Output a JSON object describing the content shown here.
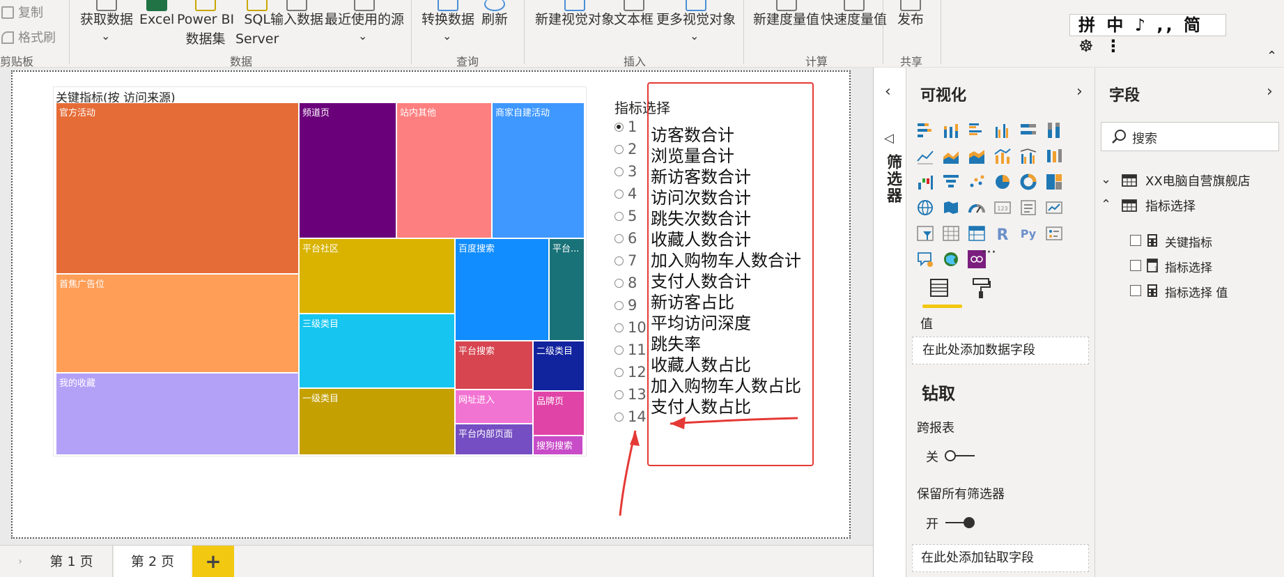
{
  "ribbon": {
    "clipboard": {
      "copy": "复制",
      "format_painter": "格式刷",
      "group": "剪贴板"
    },
    "data": {
      "get_data": "获取数据",
      "excel": "Excel",
      "powerbi_line1": "Power BI",
      "powerbi_line2": "数据集",
      "sql_line1": "SQL",
      "sql_line2": "Server",
      "enter_data": "输入数据",
      "recent_sources": "最近使用的源",
      "group": "数据"
    },
    "query": {
      "transform": "转换数据",
      "refresh": "刷新",
      "group": "查询"
    },
    "insert": {
      "new_visual": "新建视觉对象",
      "text_box": "文本框",
      "more_visuals": "更多视觉对象",
      "group": "插入"
    },
    "calc": {
      "new_measure": "新建度量值",
      "quick_measure": "快速度量值",
      "group": "计算"
    },
    "share": {
      "publish": "发布",
      "group": "共享"
    },
    "ime": "拼 中 ♪ ,, 简 ☸ ⋮"
  },
  "treemap": {
    "title": "关键指标(按 访问来源)",
    "tiles": [
      {
        "label": "官方活动",
        "color": "#E66C37"
      },
      {
        "label": "首焦广告位",
        "color": "#FE9E57"
      },
      {
        "label": "我的收藏",
        "color": "#B3A1F7"
      },
      {
        "label": "频道页",
        "color": "#6B007B"
      },
      {
        "label": "站内其他",
        "color": "#FE7F7F"
      },
      {
        "label": "商家自建活动",
        "color": "#3F98FF"
      },
      {
        "label": "平台社区",
        "color": "#D9B300"
      },
      {
        "label": "三级类目",
        "color": "#17C6F0"
      },
      {
        "label": "一级类目",
        "color": "#C4A000"
      },
      {
        "label": "百度搜索",
        "color": "#118DFF"
      },
      {
        "label": "平台...",
        "color": "#197278"
      },
      {
        "label": "平台搜索",
        "color": "#D64550"
      },
      {
        "label": "二级类目",
        "color": "#12239E"
      },
      {
        "label": "网址进入",
        "color": "#F274D2"
      },
      {
        "label": "品牌页",
        "color": "#E044A7"
      },
      {
        "label": "平台内部页面",
        "color": "#744EC2"
      },
      {
        "label": "搜狗搜索",
        "color": "#C84BC8"
      }
    ]
  },
  "slicer": {
    "title": "指标选择",
    "selected": "1",
    "items": [
      "1",
      "2",
      "3",
      "4",
      "5",
      "6",
      "7",
      "8",
      "9",
      "10",
      "11",
      "12",
      "13",
      "14"
    ]
  },
  "annotation": {
    "metrics": [
      "访客数合计",
      "浏览量合计",
      "新访客数合计",
      "访问次数合计",
      "跳失次数合计",
      "收藏人数合计",
      "加入购物车人数合计",
      "支付人数合计",
      "新访客占比",
      "平均访问深度",
      "跳失率",
      "收藏人数占比",
      "加入购物车人数占比",
      "支付人数占比"
    ],
    "color": "#E53935"
  },
  "tabs": {
    "page1": "第 1 页",
    "page2": "第 2 页",
    "add": "+"
  },
  "filters": {
    "title": "筛选器"
  },
  "visualizations": {
    "title": "可视化",
    "value_label": "值",
    "value_drop": "在此处添加数据字段",
    "drill_title": "钻取",
    "cross_report": "跨报表",
    "cross_toggle": "关",
    "keep_filters": "保留所有筛选器",
    "keep_toggle": "开",
    "drill_drop": "在此处添加钻取字段",
    "more": "···",
    "py": "Py",
    "r": "R"
  },
  "fields": {
    "title": "字段",
    "search_placeholder": "搜索",
    "tables": [
      {
        "name": "XX电脑自营旗舰店",
        "expanded": false
      },
      {
        "name": "指标选择",
        "expanded": true,
        "fields": [
          "关键指标",
          "指标选择",
          "指标选择 值"
        ]
      }
    ]
  }
}
